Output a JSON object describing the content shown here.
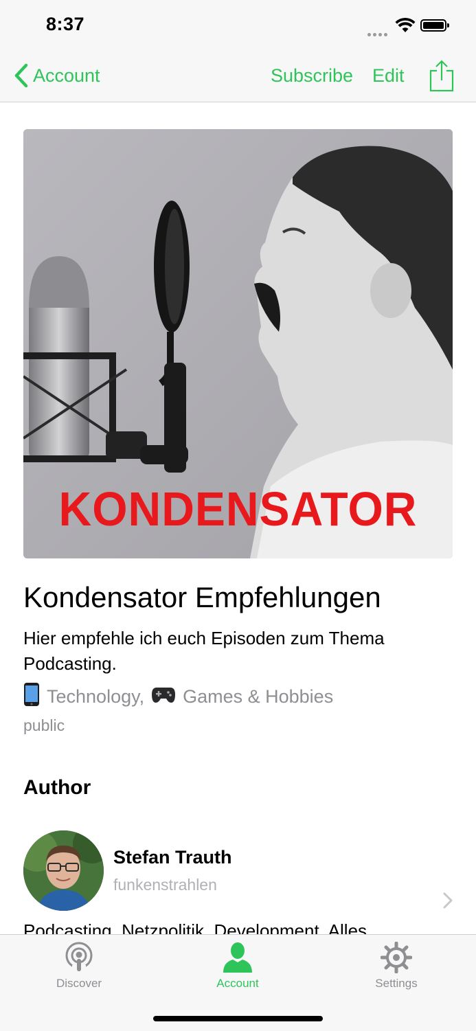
{
  "status_bar": {
    "time": "8:37"
  },
  "nav": {
    "back_label": "Account",
    "subscribe_label": "Subscribe",
    "edit_label": "Edit",
    "share_icon": "share-icon"
  },
  "cover": {
    "title": "KONDENSATOR"
  },
  "podcast": {
    "title": "Kondensator Empfehlungen",
    "description": "Hier empfehle ich euch Episoden zum Thema Podcasting.",
    "categories": [
      {
        "icon": "phone-icon",
        "label": "Technology,"
      },
      {
        "icon": "gamepad-icon",
        "label": "Games & Hobbies"
      }
    ],
    "visibility": "public"
  },
  "author": {
    "section_title": "Author",
    "name": "Stefan Trauth",
    "handle": "funkenstrahlen",
    "bio": "Podcasting, Netzpolitik, Development, Alles"
  },
  "tab_bar": {
    "tabs": [
      {
        "label": "Discover",
        "icon": "podcast-icon",
        "active": false
      },
      {
        "label": "Account",
        "icon": "person-icon",
        "active": true
      },
      {
        "label": "Settings",
        "icon": "gear-icon",
        "active": false
      }
    ]
  },
  "colors": {
    "accent": "#2fc45a",
    "secondary_text": "#8e8e93",
    "cover_title": "#e8191d"
  }
}
